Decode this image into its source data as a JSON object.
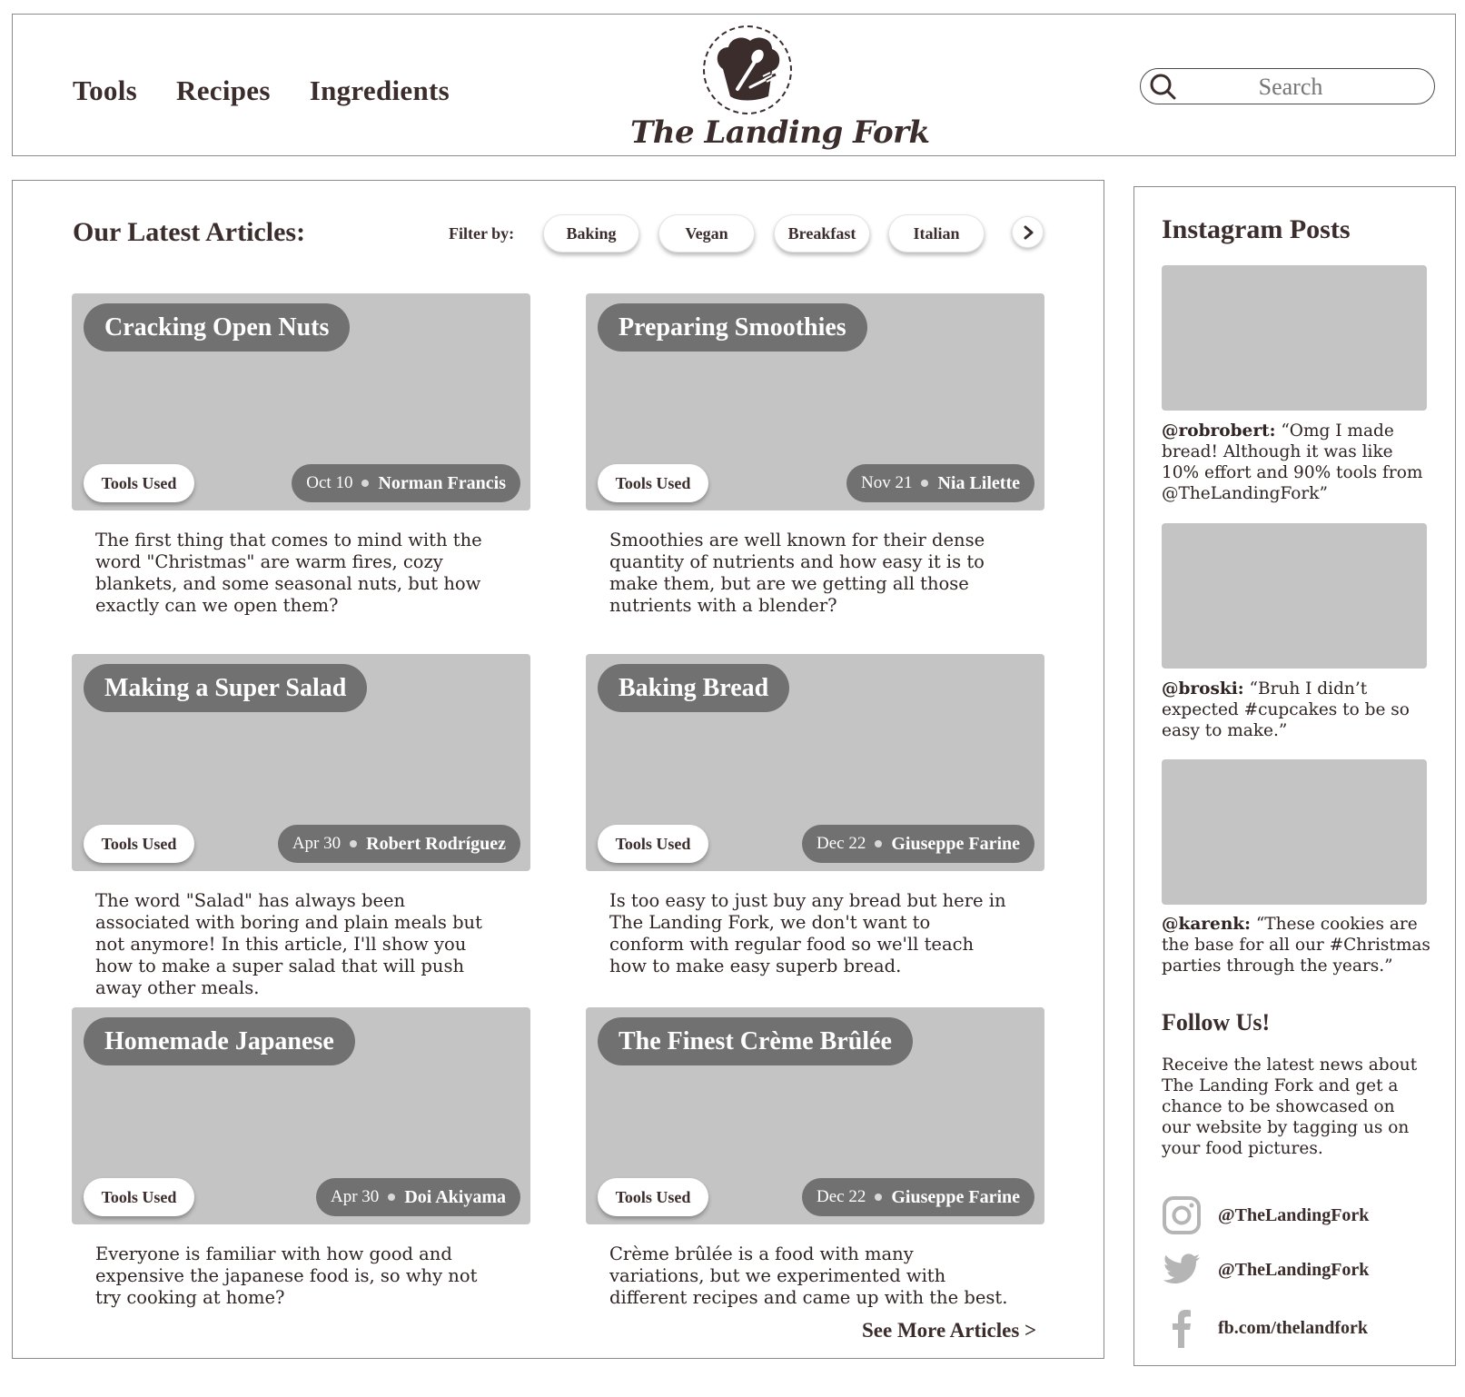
{
  "colors": {
    "text": "#3b2d2c",
    "placeholder_bg": "#c4c4c4",
    "pill_dark": "#717171"
  },
  "nav": {
    "items": [
      "Tools",
      "Recipes",
      "Ingredients"
    ]
  },
  "logo": {
    "text": "The Landing Fork",
    "icon": "chef-hat-spoon-fork-icon"
  },
  "search": {
    "placeholder": "Search",
    "icon": "search-icon"
  },
  "main": {
    "title": "Our Latest Articles:",
    "filter_label": "Filter by:",
    "filters": [
      "Baking",
      "Vegan",
      "Breakfast",
      "Italian"
    ],
    "next_icon": "chevron-right-icon",
    "see_more": "See More Articles >",
    "tools_label": "Tools Used",
    "articles": [
      {
        "title": "Cracking Open Nuts",
        "date": "Oct 10",
        "author": "Norman Francis",
        "desc": "The first thing that comes to mind with the word \"Christmas\" are warm fires, cozy blankets, and some seasonal nuts, but how exactly can we open them?"
      },
      {
        "title": "Preparing Smoothies",
        "date": "Nov 21",
        "author": "Nia Lilette",
        "desc": "Smoothies are well known for their dense quantity of nutrients and how easy it is to make them, but are we getting all those nutrients with a blender?"
      },
      {
        "title": "Making a Super Salad",
        "date": "Apr 30",
        "author": "Robert Rodríguez",
        "desc": "The word \"Salad\" has always been associated with boring and plain meals but not anymore! In this article, I'll show you how to make a super salad that will push away other meals."
      },
      {
        "title": "Baking Bread",
        "date": "Dec 22",
        "author": "Giuseppe Farine",
        "desc": "Is too easy to just buy any bread but here in The Landing Fork, we don't want to conform with regular food so we'll teach how to make easy superb bread."
      },
      {
        "title": "Homemade Japanese",
        "date": "Apr 30",
        "author": "Doi Akiyama",
        "desc": "Everyone is familiar with how good and expensive the japanese food is, so why not try cooking at home?"
      },
      {
        "title": "The Finest Crème Brûlée",
        "date": "Dec 22",
        "author": "Giuseppe Farine",
        "desc": "Crème brûlée is a food with many variations, but we experimented with different recipes and came up with the best."
      }
    ]
  },
  "sidebar": {
    "title": "Instagram Posts",
    "posts": [
      {
        "user": "@robrobert:",
        "caption": "“Omg I made bread! Although it was like 10% effort and 90% tools from @TheLandingFork”"
      },
      {
        "user": "@broski:",
        "caption": "“Bruh I didn’t expected #cupcakes to be so easy to make.”"
      },
      {
        "user": "@karenk:",
        "caption": "“These cookies are the base for all our #Christmas parties through the years.”"
      }
    ],
    "follow_title": "Follow Us!",
    "follow_desc": "Receive the latest news about The Landing Fork and get a chance to be showcased on our website by tagging us on your food pictures.",
    "socials": [
      {
        "icon": "instagram-icon",
        "label": "@TheLandingFork"
      },
      {
        "icon": "twitter-icon",
        "label": "@TheLandingFork"
      },
      {
        "icon": "facebook-icon",
        "label": "fb.com/thelandfork"
      }
    ]
  }
}
